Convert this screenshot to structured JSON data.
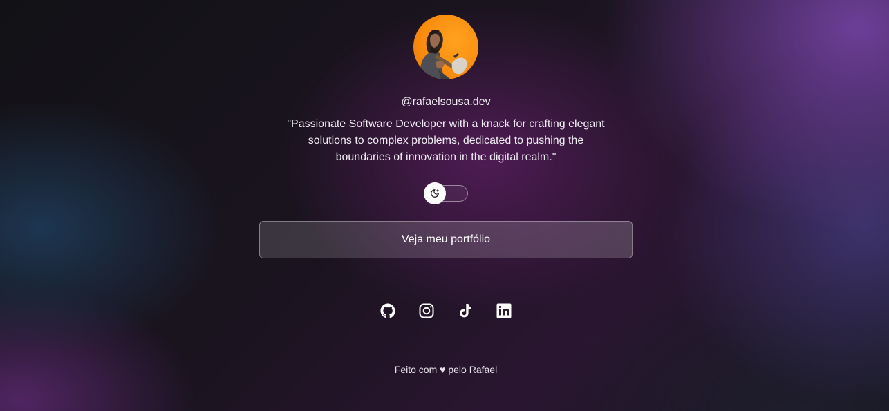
{
  "profile": {
    "avatar_alt": "avatar",
    "handle": "@rafaelsousa.dev",
    "bio": "\"Passionate Software Developer with a knack for crafting elegant solutions to complex problems, dedicated to pushing the boundaries of innovation in the digital realm.\""
  },
  "theme_toggle": {
    "icon": "moon-stars-icon",
    "state": "dark"
  },
  "portfolio_button": {
    "label": "Veja meu portfólio"
  },
  "socials": [
    {
      "name": "GitHub",
      "icon": "github-icon"
    },
    {
      "name": "Instagram",
      "icon": "instagram-icon"
    },
    {
      "name": "TikTok",
      "icon": "tiktok-icon"
    },
    {
      "name": "LinkedIn",
      "icon": "linkedin-icon"
    }
  ],
  "footer": {
    "prefix": "Feito com ♥ pelo",
    "author_link": "Rafael"
  },
  "colors": {
    "avatar_bg": "#fb8d0f",
    "text": "#ffffff"
  }
}
